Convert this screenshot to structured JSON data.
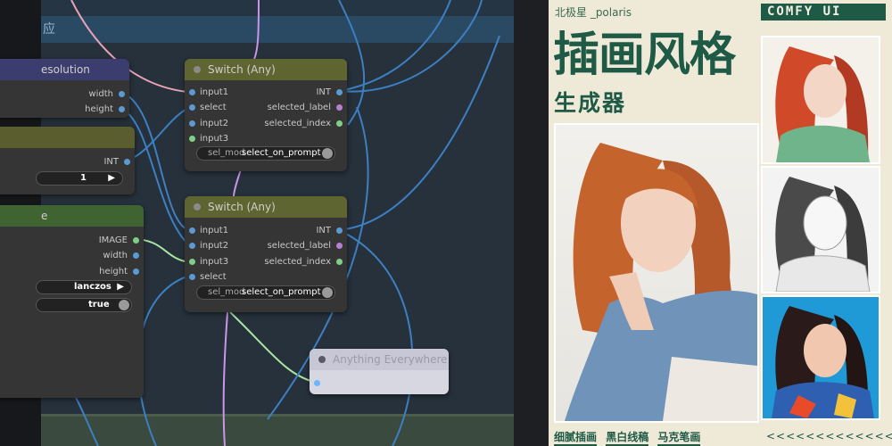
{
  "canvas": {
    "group_title": "应",
    "nodes": {
      "resolution": {
        "title": "esolution",
        "outputs": [
          "width",
          "height"
        ]
      },
      "int_node": {
        "output": "INT",
        "value": "1"
      },
      "image_node": {
        "title": "e",
        "outputs": [
          "IMAGE",
          "width",
          "height"
        ],
        "method": "lanczos",
        "flag": "true"
      },
      "switch1": {
        "title": "Switch (Any)",
        "inputs": [
          "input1",
          "select",
          "input2",
          "input3"
        ],
        "outputs": [
          "INT",
          "selected_label",
          "selected_index"
        ],
        "widget_label": "sel_mod",
        "widget_value": "select_on_prompt"
      },
      "switch2": {
        "title": "Switch (Any)",
        "inputs": [
          "input1",
          "input2",
          "input3",
          "select"
        ],
        "outputs": [
          "INT",
          "selected_label",
          "selected_index"
        ],
        "widget_label": "sel_mod",
        "widget_value": "select_on_prompt"
      },
      "anything": {
        "title": "Anything Everywhere"
      }
    },
    "colors": {
      "int_slot": "#5b9bd5",
      "image_slot": "#7fcf8a",
      "label_slot": "#b77fd0",
      "wire_blue": "#3d7fc1",
      "wire_pink": "#e7a3b6",
      "wire_purple": "#c996e8",
      "wire_green": "#a8e6a0"
    }
  },
  "poster": {
    "brand": "北极星 _polaris",
    "badge": "COMFY UI",
    "title": "插画风格",
    "subtitle": "生成器",
    "tags": [
      "细腻插画",
      "黑白线稿",
      "马克笔画"
    ],
    "chevrons": "<<<<<<<<<<<<<<<<<",
    "accent": "#1e5a46",
    "background": "#efe9d8"
  }
}
